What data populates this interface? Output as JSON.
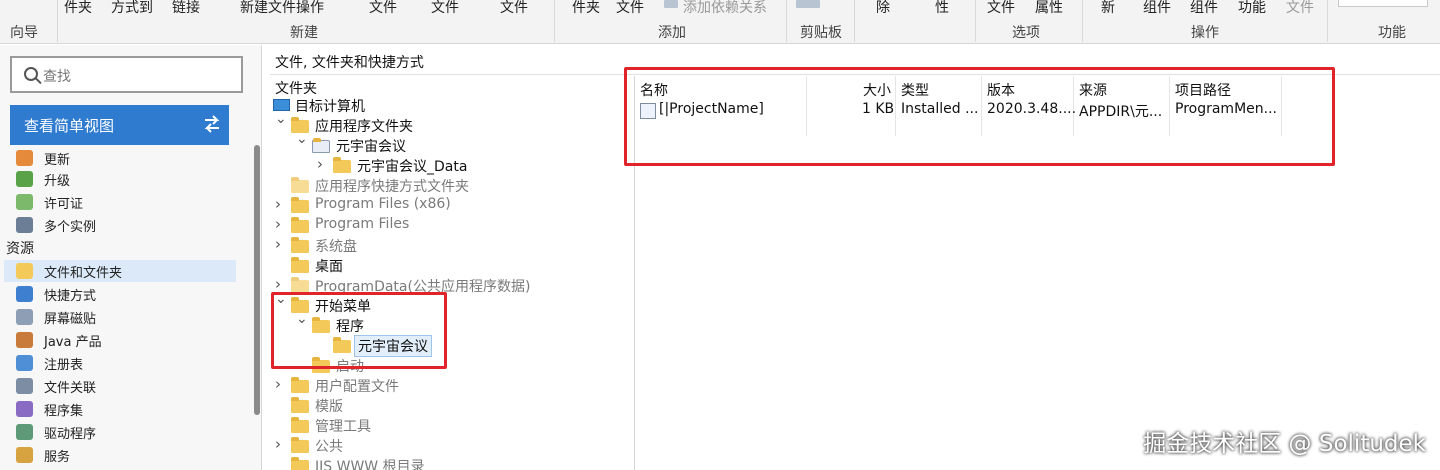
{
  "ribbon": {
    "top_items": [
      "件夹",
      "方式到",
      "链接",
      "新建文件操作",
      "文件",
      "文件",
      "文件",
      "件夹",
      "文件",
      "添加依赖关系",
      "除",
      "性",
      "文件",
      "属性",
      "新",
      "组件",
      "组件",
      "功能",
      "文件"
    ],
    "groups": [
      "向导",
      "新建",
      "添加",
      "剪贴板",
      "选项",
      "操作",
      "功能"
    ]
  },
  "sidebar": {
    "search_placeholder": "查找",
    "simple_view_label": "查看简单视图",
    "items": [
      {
        "label": "更新",
        "icon": "update-icon"
      },
      {
        "label": "升级",
        "icon": "upgrade-icon"
      },
      {
        "label": "许可证",
        "icon": "license-icon"
      },
      {
        "label": "多个实例",
        "icon": "multiple-instances-icon"
      }
    ],
    "section_label": "资源",
    "resources": [
      {
        "label": "文件和文件夹",
        "icon": "files-folders-icon",
        "selected": true
      },
      {
        "label": "快捷方式",
        "icon": "shortcut-icon"
      },
      {
        "label": "屏幕磁贴",
        "icon": "tiles-icon"
      },
      {
        "label": "Java 产品",
        "icon": "java-icon"
      },
      {
        "label": "注册表",
        "icon": "registry-icon"
      },
      {
        "label": "文件关联",
        "icon": "file-association-icon"
      },
      {
        "label": "程序集",
        "icon": "assembly-icon"
      },
      {
        "label": "驱动程序",
        "icon": "driver-icon"
      },
      {
        "label": "服务",
        "icon": "services-icon"
      }
    ]
  },
  "main": {
    "path_title": "文件, 文件夹和快捷方式",
    "tree_header": "文件夹",
    "tree": [
      {
        "label": "目标计算机",
        "depth": 0,
        "arrow": "",
        "icon": "computer-icon"
      },
      {
        "label": "应用程序文件夹",
        "depth": 0,
        "arrow": "v"
      },
      {
        "label": "元宇宙会议",
        "depth": 1,
        "arrow": "v",
        "icon": "app-folder-icon"
      },
      {
        "label": "元宇宙会议_Data",
        "depth": 2,
        "arrow": ">"
      },
      {
        "label": "应用程序快捷方式文件夹",
        "depth": 0,
        "arrow": "",
        "grey": true,
        "pale": true
      },
      {
        "label": "Program Files (x86)",
        "depth": 0,
        "arrow": ">",
        "grey": true
      },
      {
        "label": "Program Files",
        "depth": 0,
        "arrow": ">",
        "grey": true
      },
      {
        "label": "系统盘",
        "depth": 0,
        "arrow": ">",
        "grey": true
      },
      {
        "label": "桌面",
        "depth": 0,
        "arrow": ""
      },
      {
        "label": "ProgramData(公共应用程序数据)",
        "depth": 0,
        "arrow": ">",
        "grey": true,
        "pale": true
      },
      {
        "label": "开始菜单",
        "depth": 0,
        "arrow": "v"
      },
      {
        "label": "程序",
        "depth": 1,
        "arrow": "v"
      },
      {
        "label": "元宇宙会议",
        "depth": 2,
        "arrow": "",
        "highlight": true
      },
      {
        "label": "启动",
        "depth": 1,
        "arrow": "",
        "grey": true
      },
      {
        "label": "用户配置文件",
        "depth": 0,
        "arrow": ">",
        "grey": true
      },
      {
        "label": "模版",
        "depth": 0,
        "arrow": "",
        "grey": true
      },
      {
        "label": "管理工具",
        "depth": 0,
        "arrow": "",
        "grey": true
      },
      {
        "label": "公共",
        "depth": 0,
        "arrow": ">",
        "grey": true
      },
      {
        "label": "IIS WWW 根目录",
        "depth": 0,
        "arrow": "",
        "grey": true
      }
    ],
    "columns": [
      "名称",
      "大小",
      "类型",
      "版本",
      "来源",
      "项目路径"
    ],
    "rows": [
      {
        "name": "[|ProjectName]",
        "size": "1 KB",
        "type": "Installed ...",
        "version": "2020.3.48....",
        "source": "APPDIR\\元...",
        "path": "ProgramMen..."
      }
    ]
  },
  "watermark": "掘金技术社区 @ Solitudek",
  "colors": {
    "accent": "#2f7bd0",
    "annotation": "#e0242a",
    "folder": "#f3c95a",
    "selection": "#dbe9f9"
  }
}
